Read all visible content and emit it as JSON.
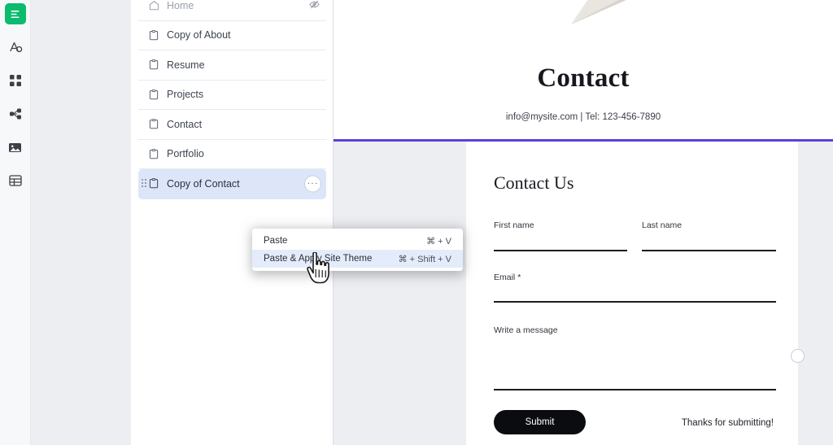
{
  "rail": {
    "items": [
      {
        "name": "editor-logo",
        "icon": "wix-editor-icon",
        "active": true
      },
      {
        "name": "add-elements",
        "icon": "add-elements-icon",
        "active": false
      },
      {
        "name": "apps",
        "icon": "apps-grid-icon",
        "active": false
      },
      {
        "name": "media-manager",
        "icon": "media-flow-icon",
        "active": false
      },
      {
        "name": "my-uploads",
        "icon": "image-icon",
        "active": false
      },
      {
        "name": "cms",
        "icon": "table-icon",
        "active": false
      }
    ]
  },
  "pages_panel": {
    "pages": [
      {
        "label": "Home",
        "icon": "home-icon",
        "state": "muted",
        "trailing": "hidden-eye-icon"
      },
      {
        "label": "Copy of About",
        "icon": "page-icon",
        "state": "normal",
        "trailing": ""
      },
      {
        "label": "Resume",
        "icon": "page-icon",
        "state": "normal",
        "trailing": ""
      },
      {
        "label": "Projects",
        "icon": "page-icon",
        "state": "normal",
        "trailing": ""
      },
      {
        "label": "Contact",
        "icon": "page-icon",
        "state": "normal",
        "trailing": ""
      },
      {
        "label": "Portfolio",
        "icon": "page-icon",
        "state": "normal",
        "trailing": ""
      },
      {
        "label": "Copy of Contact",
        "icon": "page-icon",
        "state": "selected",
        "trailing": "more-actions-icon"
      }
    ],
    "more_label": "···"
  },
  "context_menu": {
    "items": [
      {
        "label": "Paste",
        "shortcut": "⌘ + V",
        "hovered": false
      },
      {
        "label": "Paste & Apply Site Theme",
        "shortcut": "⌘ + Shift + V",
        "hovered": true
      }
    ]
  },
  "site": {
    "hero": {
      "title": "Contact",
      "subtitle": "info@mysite.com | Tel: 123-456-7890"
    },
    "form": {
      "heading": "Contact Us",
      "fields": [
        {
          "label": "First name",
          "required": false
        },
        {
          "label": "Last name",
          "required": false
        },
        {
          "label": "Email",
          "required": true
        },
        {
          "label": "Write a message",
          "required": false
        }
      ],
      "required_mark": "*",
      "submit_label": "Submit",
      "confirmation_text": "Thanks for submitting!"
    }
  },
  "colors": {
    "accent_green": "#0bbb6e",
    "selection_blue": "#dce6f8",
    "menu_hover_blue": "#e4ecfb",
    "divider_purple": "#5b3fd8",
    "canvas_gray": "#eceef1"
  }
}
